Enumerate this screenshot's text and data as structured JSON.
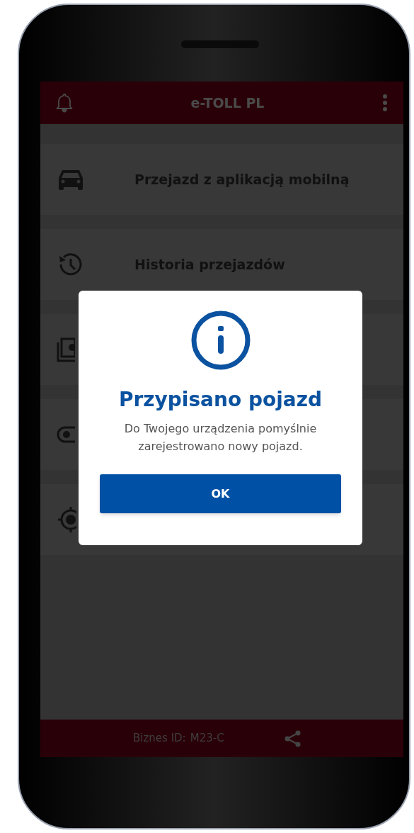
{
  "app_bar": {
    "title": "e-TOLL PL"
  },
  "menu_items": [
    {
      "kind": "car",
      "label": "Przejazd z aplikacją mobilną"
    },
    {
      "kind": "history",
      "label": "Historia przejazdów"
    },
    {
      "kind": "money"
    },
    {
      "kind": "toggle"
    },
    {
      "kind": "target"
    }
  ],
  "dialog": {
    "title": "Przypisano pojazd",
    "message": "Do Twojego urządzenia pomyślnie zarejestrowano nowy pojazd.",
    "button": "OK"
  },
  "footer": {
    "label": "Biznes ID:",
    "value": "M23-C"
  }
}
